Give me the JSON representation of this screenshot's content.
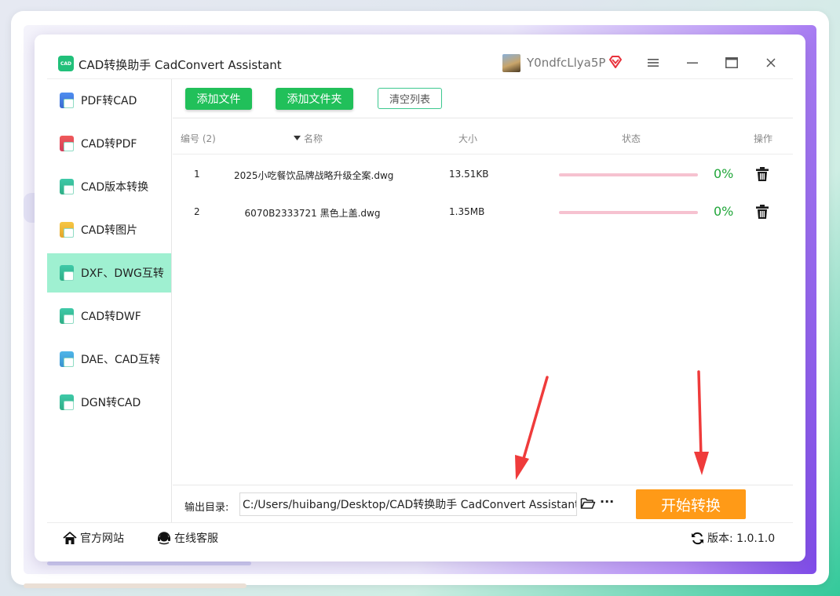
{
  "window": {
    "logo_text": "CAD",
    "title": "CAD转换助手 CadConvert Assistant",
    "username": "Y0ndfcLlya5P"
  },
  "sidebar": {
    "items": [
      {
        "label": "PDF转CAD",
        "icon": "pdf-to-cad-icon"
      },
      {
        "label": "CAD转PDF",
        "icon": "cad-to-pdf-icon"
      },
      {
        "label": "CAD版本转换",
        "icon": "cad-version-icon"
      },
      {
        "label": "CAD转图片",
        "icon": "cad-to-image-icon"
      },
      {
        "label": "DXF、DWG互转",
        "icon": "dxf-dwg-icon",
        "active": true
      },
      {
        "label": "CAD转DWF",
        "icon": "cad-to-dwf-icon"
      },
      {
        "label": "DAE、CAD互转",
        "icon": "dae-cad-icon"
      },
      {
        "label": "DGN转CAD",
        "icon": "dgn-to-cad-icon"
      }
    ]
  },
  "toolbar": {
    "add_file": "添加文件",
    "add_folder": "添加文件夹",
    "clear_list": "清空列表"
  },
  "table": {
    "headers": {
      "index": "编号 (2)",
      "name": "名称",
      "size": "大小",
      "status": "状态",
      "operation": "操作"
    },
    "rows": [
      {
        "index": "1",
        "name": "2025小吃餐饮品牌战略升级全案.dwg",
        "size": "13.51KB",
        "progress_percent": 0,
        "progress_label": "0%"
      },
      {
        "index": "2",
        "name": "6070B2333721 黑色上盖.dwg",
        "size": "1.35MB",
        "progress_percent": 0,
        "progress_label": "0%"
      }
    ]
  },
  "output": {
    "label": "输出目录:",
    "path": "C:/Users/huibang/Desktop/CAD转换助手 CadConvert Assistant",
    "more": "···"
  },
  "start_button": "开始转换",
  "footer": {
    "website": "官方网站",
    "service": "在线客服",
    "version": "版本: 1.0.1.0"
  },
  "colors": {
    "accent_green": "#21c05a",
    "active_sidebar": "#9ff0d1",
    "start_orange": "#ff9a17",
    "progress_track": "#f6c2d0",
    "percent_green": "#21a63a",
    "annotation_red": "#ef3b3b"
  }
}
